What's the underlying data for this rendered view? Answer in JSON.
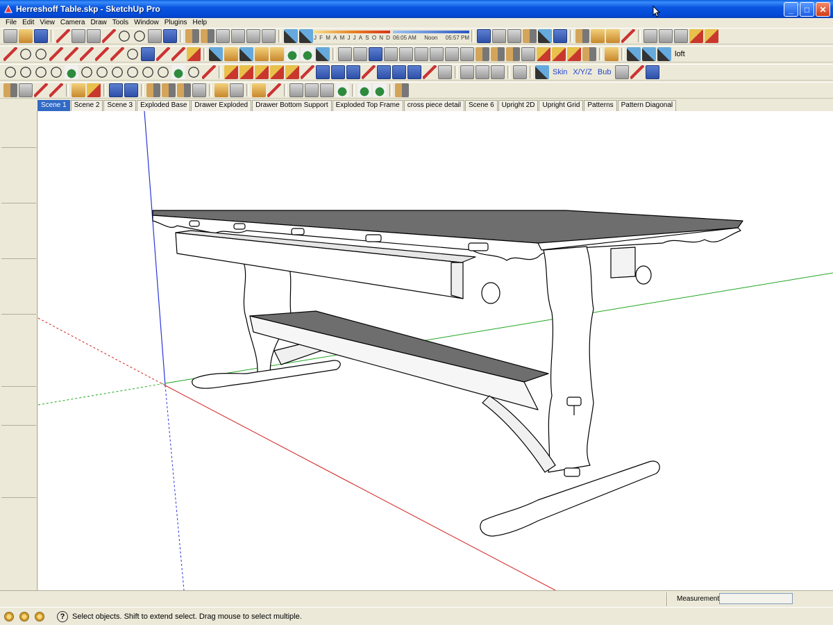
{
  "window": {
    "title": "Herreshoff Table.skp - SketchUp Pro",
    "minimize": "_",
    "maximize": "□",
    "close": "✕"
  },
  "menu": [
    "File",
    "Edit",
    "View",
    "Camera",
    "Draw",
    "Tools",
    "Window",
    "Plugins",
    "Help"
  ],
  "shadow": {
    "months": [
      "J",
      "F",
      "M",
      "A",
      "M",
      "J",
      "J",
      "A",
      "S",
      "O",
      "N",
      "D"
    ],
    "time_start": "06:05 AM",
    "time_mid": "Noon",
    "time_end": "05:57 PM"
  },
  "toolbar_labels": {
    "skin": "Skin",
    "xyz": "X/Y/Z",
    "bub": "Bub",
    "loft": "loft"
  },
  "scenes": [
    {
      "label": "Scene 1",
      "active": true
    },
    {
      "label": "Scene 2"
    },
    {
      "label": "Scene 3"
    },
    {
      "label": "Exploded Base"
    },
    {
      "label": "Drawer Exploded"
    },
    {
      "label": "Drawer Bottom Support"
    },
    {
      "label": "Exploded Top Frame"
    },
    {
      "label": "cross piece detail"
    },
    {
      "label": "Scene 6"
    },
    {
      "label": "Upright 2D"
    },
    {
      "label": "Upright Grid"
    },
    {
      "label": "Patterns"
    },
    {
      "label": "Pattern Diagonal"
    }
  ],
  "status": {
    "text": "Select objects. Shift to extend select. Drag mouse to select multiple.",
    "help": "?",
    "measurements_label": "Measurements",
    "measurements_value": ""
  },
  "colors": {
    "axis_red": "#d21f1f",
    "axis_green": "#1fa51f",
    "axis_blue": "#2a35d8",
    "active_tab": "#316ac5"
  }
}
